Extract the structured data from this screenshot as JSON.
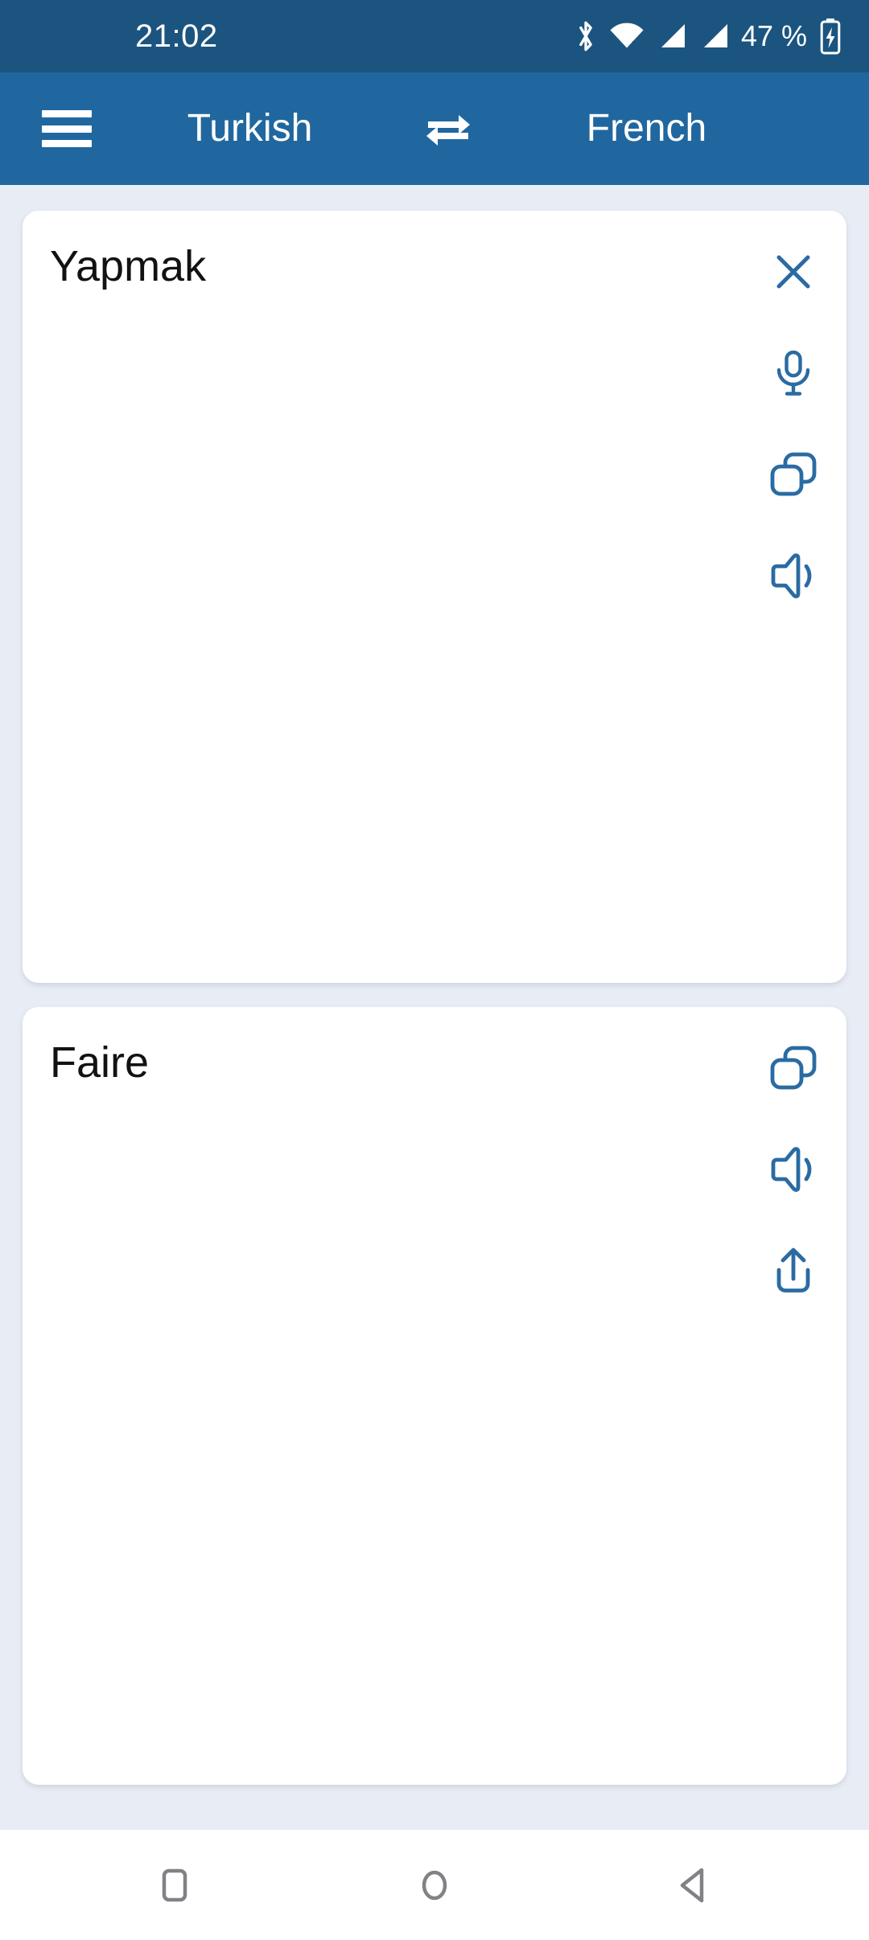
{
  "status_bar": {
    "time": "21:02",
    "battery_percent": "47 %",
    "icons": [
      "bluetooth-icon",
      "wifi-icon",
      "signal-sim1-icon",
      "signal-sim2-icon",
      "battery-charging-icon"
    ],
    "background_color": "#1c5480",
    "foreground_color": "#ffffff"
  },
  "app_bar": {
    "menu_icon": "hamburger-menu-icon",
    "source_language": "Turkish",
    "swap_icon": "swap-horizontal-icon",
    "target_language": "French",
    "background_color": "#21679f",
    "foreground_color": "#ffffff"
  },
  "source_card": {
    "text": "Yapmak",
    "actions": [
      {
        "name": "clear-button",
        "icon": "close-icon"
      },
      {
        "name": "voice-input-button",
        "icon": "microphone-icon"
      },
      {
        "name": "copy-button",
        "icon": "copy-icon"
      },
      {
        "name": "speak-button",
        "icon": "speaker-icon"
      }
    ]
  },
  "target_card": {
    "text": "Faire",
    "actions": [
      {
        "name": "copy-button",
        "icon": "copy-icon"
      },
      {
        "name": "speak-button",
        "icon": "speaker-icon"
      },
      {
        "name": "share-button",
        "icon": "share-upload-icon"
      }
    ]
  },
  "nav_bar": {
    "buttons": [
      {
        "name": "recents-button",
        "icon": "square-icon"
      },
      {
        "name": "home-button",
        "icon": "circle-icon"
      },
      {
        "name": "back-button",
        "icon": "triangle-left-icon"
      }
    ],
    "background_color": "#ffffff",
    "icon_color": "#808286"
  },
  "theme": {
    "page_background": "#e8edf5",
    "card_background": "#ffffff",
    "accent_icon_color": "#2a6ba3",
    "text_color": "#121212"
  }
}
